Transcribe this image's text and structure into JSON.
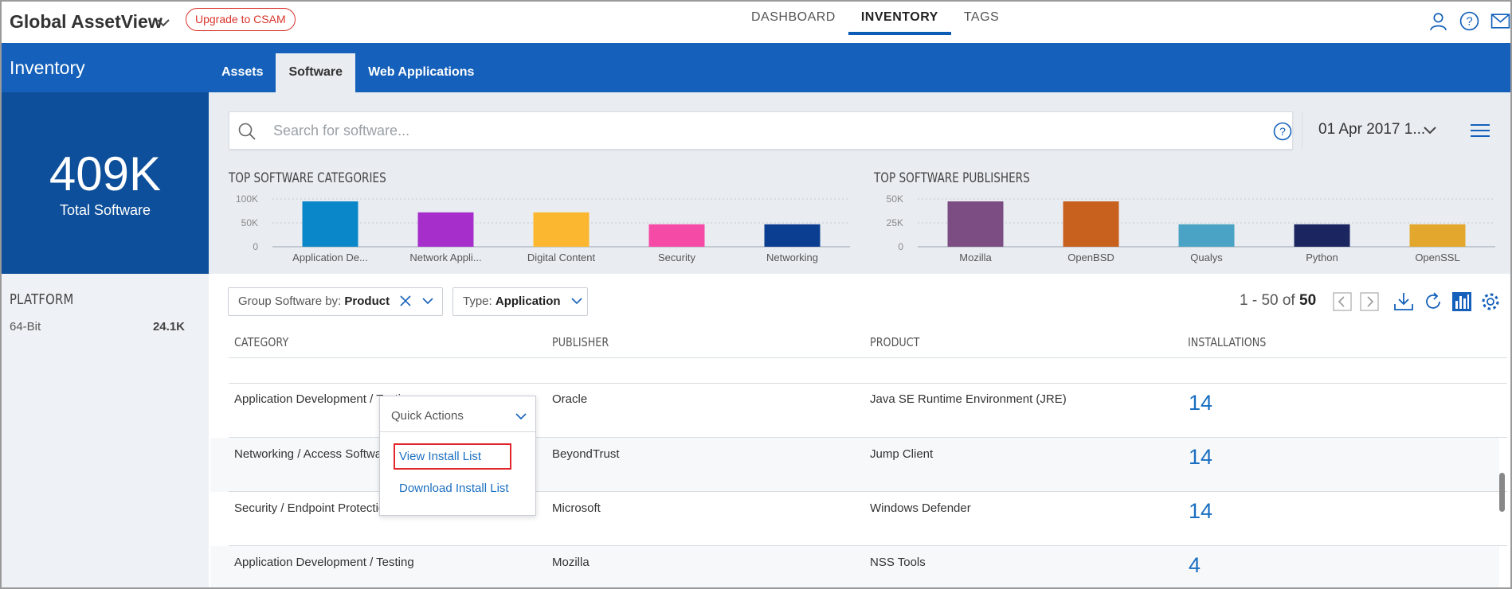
{
  "app": {
    "title": "Global AssetView",
    "upgrade_label": "Upgrade to CSAM"
  },
  "nav": {
    "tabs": [
      "DASHBOARD",
      "INVENTORY",
      "TAGS"
    ],
    "active": "INVENTORY"
  },
  "section": {
    "title": "Inventory",
    "subtabs": [
      "Assets",
      "Software",
      "Web Applications"
    ],
    "active_subtab": "Software"
  },
  "summary": {
    "value": "409K",
    "label": "Total Software"
  },
  "platform": {
    "title": "PLATFORM",
    "items": [
      {
        "label": "64-Bit",
        "value": "24.1K"
      }
    ]
  },
  "search": {
    "placeholder": "Search for software...",
    "date": "01 Apr 2017 1..."
  },
  "charts": [
    {
      "title": "TOP SOFTWARE CATEGORIES",
      "type": "bar",
      "categories": [
        "Application De...",
        "Network Appli...",
        "Digital Content",
        "Security",
        "Networking"
      ],
      "values": [
        95000,
        72000,
        72000,
        47000,
        47000
      ],
      "yticks": [
        "100K",
        "50K",
        "0"
      ],
      "ylim": [
        0,
        100000
      ],
      "colors": [
        "#0a87c8",
        "#a62fcc",
        "#fbb72f",
        "#f64aa7",
        "#0b3d91"
      ]
    },
    {
      "title": "TOP SOFTWARE PUBLISHERS",
      "type": "bar",
      "categories": [
        "Mozilla",
        "OpenBSD",
        "Qualys",
        "Python",
        "OpenSSL"
      ],
      "values": [
        47500,
        47500,
        23500,
        23500,
        23500
      ],
      "yticks": [
        "50K",
        "25K",
        "0"
      ],
      "ylim": [
        0,
        50000
      ],
      "colors": [
        "#7b4d82",
        "#c8601e",
        "#4aa3c4",
        "#1b2560",
        "#e2a72c"
      ]
    }
  ],
  "chart_data": [
    {
      "type": "bar",
      "title": "TOP SOFTWARE CATEGORIES",
      "categories": [
        "Application De...",
        "Network Appli...",
        "Digital Content",
        "Security",
        "Networking"
      ],
      "values": [
        95000,
        72000,
        72000,
        47000,
        47000
      ],
      "ylim": [
        0,
        100000
      ]
    },
    {
      "type": "bar",
      "title": "TOP SOFTWARE PUBLISHERS",
      "categories": [
        "Mozilla",
        "OpenBSD",
        "Qualys",
        "Python",
        "OpenSSL"
      ],
      "values": [
        47500,
        47500,
        23500,
        23500,
        23500
      ],
      "ylim": [
        0,
        50000
      ]
    }
  ],
  "filters": {
    "group_label": "Group Software by:",
    "group_value": "Product",
    "type_label": "Type:",
    "type_value": "Application"
  },
  "pager": {
    "range": "1 - 50 of",
    "total": "50"
  },
  "table": {
    "headers": [
      "CATEGORY",
      "PUBLISHER",
      "PRODUCT",
      "INSTALLATIONS"
    ],
    "rows": [
      {
        "category": "Application Development / Testing",
        "publisher": "Oracle",
        "product": "Java SE Runtime Environment (JRE)",
        "installations": "14"
      },
      {
        "category": "Networking / Access Software",
        "publisher": "BeyondTrust",
        "product": "Jump Client",
        "installations": "14"
      },
      {
        "category": "Security / Endpoint Protection",
        "publisher": "Microsoft",
        "product": "Windows Defender",
        "installations": "14"
      },
      {
        "category": "Application Development / Testing",
        "publisher": "Mozilla",
        "product": "NSS Tools",
        "installations": "4"
      }
    ]
  },
  "quick_actions": {
    "label": "Quick Actions",
    "items": [
      "View Install List",
      "Download Install List"
    ]
  },
  "icons": {
    "user": "user-icon",
    "help": "help-icon",
    "mail": "mail-icon",
    "search": "search-icon",
    "menu": "menu-icon",
    "download": "download-icon",
    "refresh": "refresh-icon",
    "chart": "bar-chart-icon",
    "settings": "gear-icon"
  },
  "colors": {
    "brand_blue": "#1460ba",
    "stat_blue": "#0d4f9a",
    "link_blue": "#1a6fc0",
    "alert_red": "#d9342b"
  }
}
